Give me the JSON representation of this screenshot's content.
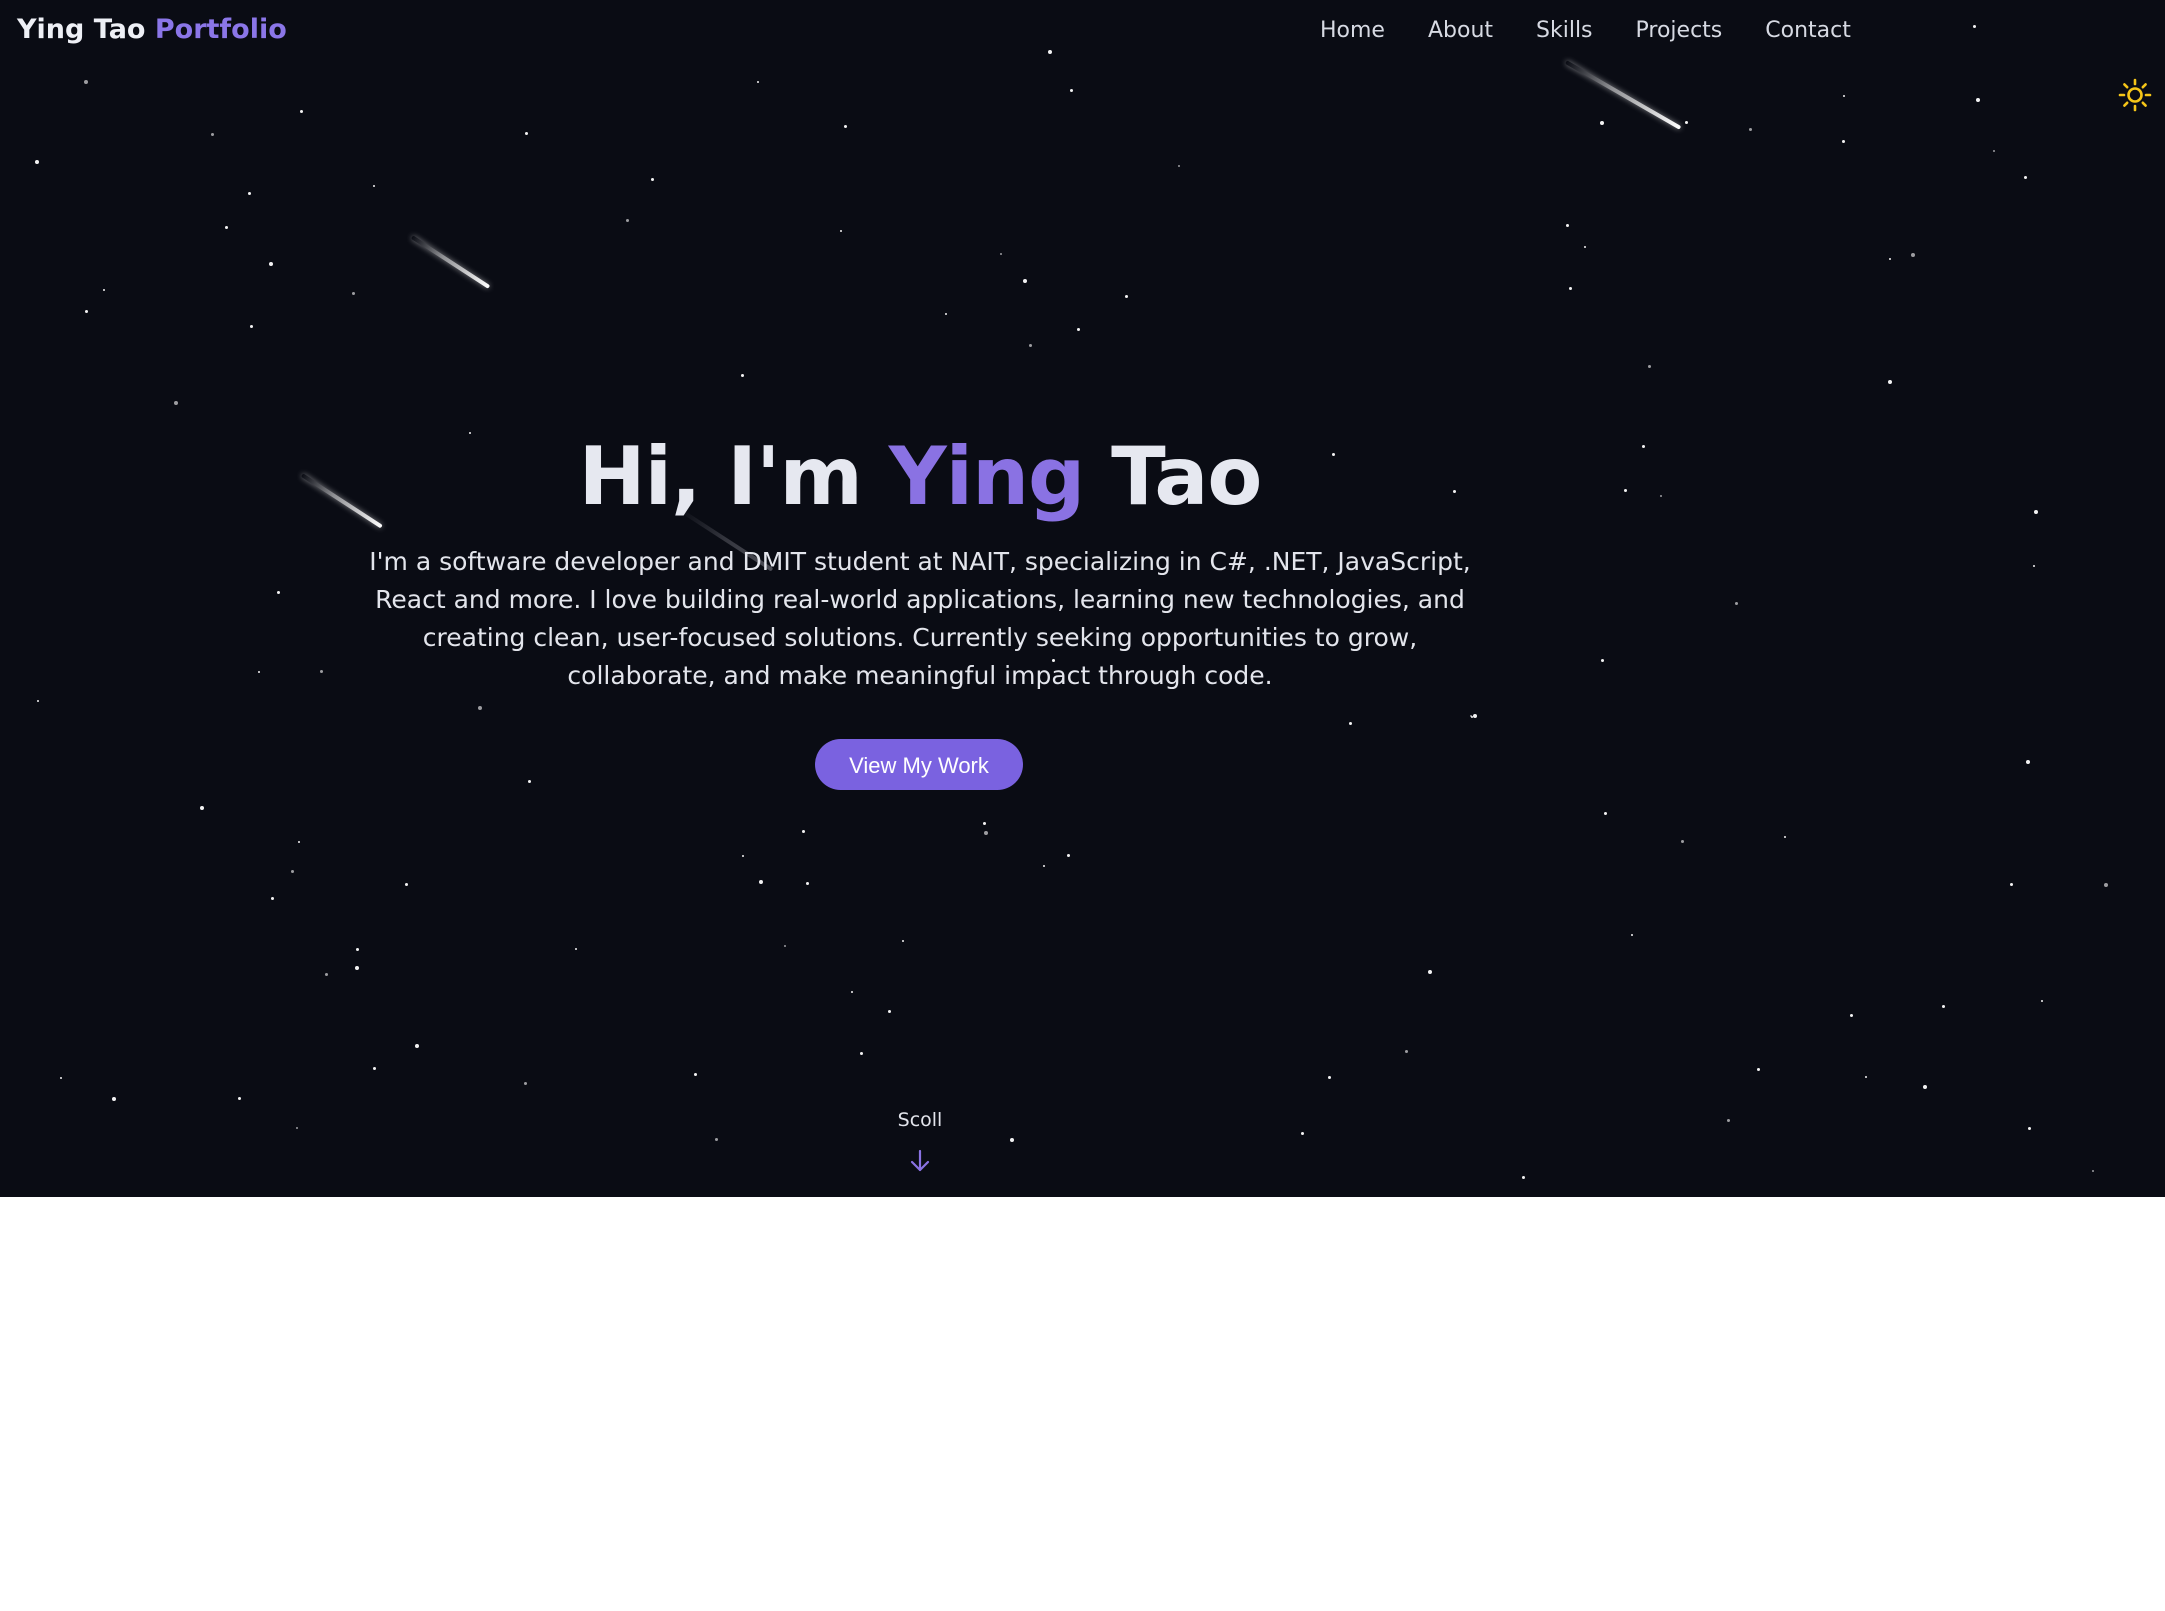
{
  "header": {
    "brand_name": "Ying Tao",
    "brand_suffix": "Portfolio",
    "nav": [
      {
        "label": "Home"
      },
      {
        "label": "About"
      },
      {
        "label": "Skills"
      },
      {
        "label": "Projects"
      },
      {
        "label": "Contact"
      }
    ],
    "theme_toggle_icon": "sun-icon"
  },
  "hero": {
    "greeting": "Hi, I'm",
    "first_name": "Ying",
    "last_name": "Tao",
    "description": "I'm a software developer and DMIT student at NAIT, specializing in C#, .NET, JavaScript, React and more. I love building real-world applications, learning new technologies, and creating clean, user-focused solutions. Currently seeking opportunities to grow, collaborate, and make meaningful impact through code.",
    "cta_label": "View My Work",
    "scroll_label": "Scoll",
    "scroll_icon": "arrow-down-icon"
  },
  "colors": {
    "background": "#0a0c14",
    "accent": "#8a72e3",
    "button": "#7a62e0",
    "sun": "#f5c518",
    "text": "#e6e8f0"
  }
}
